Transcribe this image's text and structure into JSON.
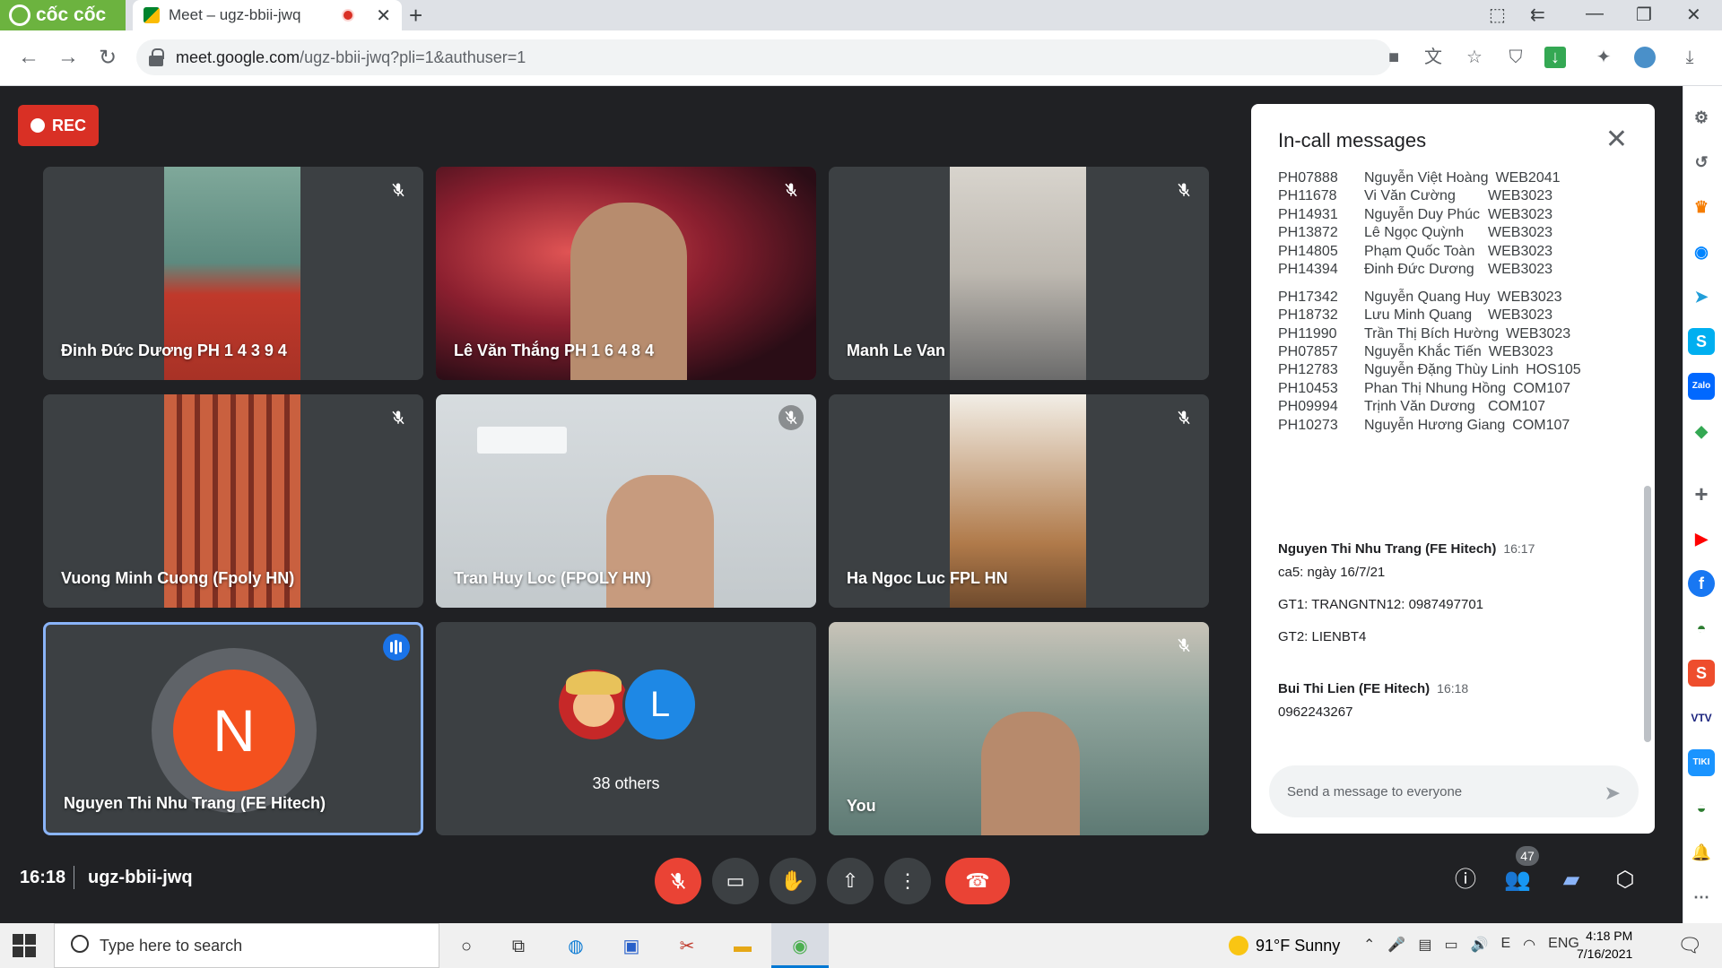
{
  "browser": {
    "brand": "cốc cốc",
    "tab_title": "Meet – ugz-bbii-jwq",
    "url_host": "meet.google.com",
    "url_path": "/ugz-bbii-jwq?pli=1&authuser=1"
  },
  "meet": {
    "rec_label": "REC",
    "tiles": [
      {
        "name": "Đinh Đức Dương PH 1 4 3 9 4"
      },
      {
        "name": "Lê Văn Thắng PH 1 6 4 8 4"
      },
      {
        "name": "Manh Le Van"
      },
      {
        "name": "Vuong Minh Cuong (Fpoly HN)"
      },
      {
        "name": "Tran Huy Loc (FPOLY HN)"
      },
      {
        "name": "Ha Ngoc Luc FPL HN"
      },
      {
        "name": "Nguyen Thi Nhu Trang (FE Hitech)",
        "avatar_letter": "N",
        "avatar_color": "#f4511e"
      },
      {
        "name": "38 others",
        "avatar_letter": "L",
        "avatar_color": "#1e88e5"
      },
      {
        "name": "You"
      }
    ],
    "time": "16:18",
    "meeting_code": "ugz-bbii-jwq",
    "people_count": "47"
  },
  "chat": {
    "title": "In-call messages",
    "list": [
      {
        "id": "PH07888",
        "name": "Nguyễn Việt Hoàng",
        "course": "WEB2041"
      },
      {
        "id": "PH11678",
        "name": "Vi Văn Cường",
        "course": "WEB3023"
      },
      {
        "id": "PH14931",
        "name": "Nguyễn Duy Phúc",
        "course": "WEB3023"
      },
      {
        "id": "PH13872",
        "name": "Lê Ngọc Quỳnh",
        "course": "WEB3023"
      },
      {
        "id": "PH14805",
        "name": "Phạm Quốc Toàn",
        "course": "WEB3023"
      },
      {
        "id": "PH14394",
        "name": "Đinh Đức Dương",
        "course": "WEB3023"
      },
      {
        "id": "PH17342",
        "name": "Nguyễn Quang Huy",
        "course": "WEB3023"
      },
      {
        "id": "PH18732",
        "name": "Lưu Minh Quang",
        "course": "WEB3023"
      },
      {
        "id": "PH11990",
        "name": "Trần Thị Bích Hường",
        "course": "WEB3023"
      },
      {
        "id": "PH07857",
        "name": "Nguyễn Khắc Tiến",
        "course": "WEB3023"
      },
      {
        "id": "PH12783",
        "name": "Nguyễn Đặng Thùy Linh",
        "course": "HOS105"
      },
      {
        "id": "PH10453",
        "name": "Phan Thị Nhung Hồng",
        "course": "COM107"
      },
      {
        "id": "PH09994",
        "name": "Trịnh Văn Dương",
        "course": "COM107"
      },
      {
        "id": "PH10273",
        "name": "Nguyễn Hương Giang",
        "course": "COM107"
      }
    ],
    "messages": [
      {
        "sender": "Nguyen Thi Nhu Trang (FE Hitech)",
        "time": "16:17",
        "lines": [
          "ca5: ngày 16/7/21",
          "GT1: TRANGNTN12: 0987497701",
          "GT2: LIENBT4"
        ]
      },
      {
        "sender": "Bui Thi Lien (FE Hitech)",
        "time": "16:18",
        "lines": [
          "0962243267"
        ]
      }
    ],
    "input_placeholder": "Send a message to everyone"
  },
  "taskbar": {
    "search_placeholder": "Type here to search",
    "weather": "91°F  Sunny",
    "lang": "ENG",
    "time": "4:18 PM",
    "date": "7/16/2021"
  },
  "colors": {
    "accent": "#1a73e8",
    "danger": "#ea4335",
    "brand": "#6cb33f"
  }
}
